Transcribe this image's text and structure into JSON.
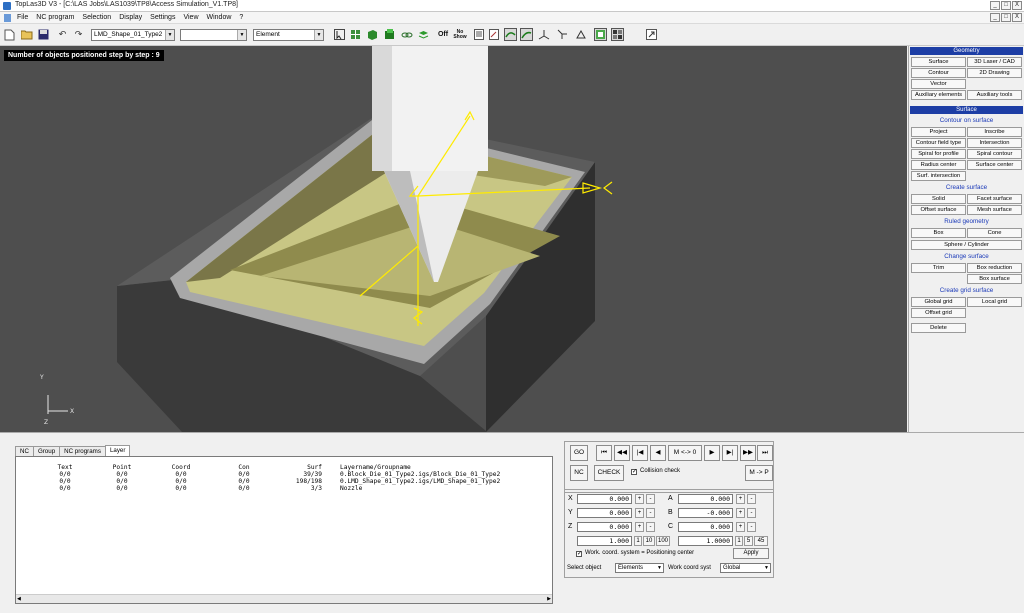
{
  "window": {
    "title": "TopLas3D V3 - [C:\\LAS Jobs\\LAS1039\\TP8\\Access Simulation_V1.TP8]",
    "minimize": "_",
    "maximize": "□",
    "close": "X"
  },
  "menu": [
    "File",
    "NC program",
    "Selection",
    "Display",
    "Settings",
    "View",
    "Window",
    "?"
  ],
  "toolbar": {
    "object_select": "LMD_Shape_01_Type2",
    "empty_select": "",
    "mode_select": "Element",
    "off_label": "Off",
    "no_show_label": "No Show"
  },
  "viewport": {
    "status": "Number of objects positioned step by step :  9"
  },
  "right_panel": {
    "geometry_header": "Geometry",
    "geometry_buttons": [
      "Surface",
      "3D Laser / CAD",
      "Contour",
      "2D Drawing",
      "Vector",
      "",
      "Auxiliary elements",
      "Auxiliary tools"
    ],
    "surface_header": "Surface",
    "contour_on_surface_title": "Contour on surface",
    "contour_on_surface_buttons": [
      "Project",
      "Inscribe",
      "Contour field type",
      "Intersection",
      "Spiral for profile",
      "Spiral contour",
      "Radius center",
      "Surface center",
      "Surf. intersection",
      ""
    ],
    "create_surface_title": "Create surface",
    "create_surface_buttons": [
      "Solid",
      "Facet surface",
      "Offset surface",
      "Mesh surface"
    ],
    "ruled_geometry_title": "Ruled geometry",
    "ruled_geometry_buttons": [
      "Box",
      "Cone"
    ],
    "sphere_cylinder": "Sphere / Cylinder",
    "change_surface_title": "Change surface",
    "change_surface_buttons": [
      "Trim",
      "Box reduction",
      "",
      "Box surface"
    ],
    "create_grid_title": "Create grid surface",
    "create_grid_buttons": [
      "Global grid",
      "Local grid",
      "Offset grid",
      ""
    ],
    "delete": "Delete"
  },
  "bottom_tabs": [
    "NC",
    "Group",
    "NC programs",
    "Layer"
  ],
  "layer_table": {
    "headers": [
      "Text",
      "Point",
      "Coord",
      "Con",
      "Surf",
      "Layername/Groupname"
    ],
    "rows": [
      [
        "0/0",
        "0/0",
        "0/0",
        "0/0",
        "39/39",
        "0.Block_Die_01_Type2.igs/Block_Die_01_Type2"
      ],
      [
        "0/0",
        "0/0",
        "0/0",
        "0/0",
        "198/198",
        "0.LMD_Shape_01_Type2.igs/LMD_Shape_01_Type2"
      ],
      [
        "0/0",
        "0/0",
        "0/0",
        "0/0",
        "3/3",
        "Nozzle"
      ]
    ]
  },
  "nc_controls": {
    "go": "GO",
    "first": "⏮",
    "fast_back": "◀◀",
    "step_back_bar": "|◀",
    "back": "◀",
    "m_to_0": "M <-> 0",
    "forward": "▶",
    "step_fwd_bar": "▶|",
    "fast_fwd": "▶▶",
    "last": "⏭",
    "nc": "NC",
    "check": "CHECK",
    "collision_check": "Collision check",
    "m_to_p": "M -> P"
  },
  "coords": {
    "X": "0.000",
    "Y": "0.000",
    "Z": "0.000",
    "A": "0.000",
    "B": "-0.000",
    "C": "0.000",
    "step_linear": "1.000",
    "step_angular": "1.0000",
    "linear_steps": [
      "1",
      "10",
      "100"
    ],
    "angular_steps": [
      "1",
      "5",
      "45"
    ],
    "plus": "+",
    "minus": "-",
    "work_coord_text": "Work. coord. system = Positioning center",
    "apply": "Apply",
    "select_object_label": "Select object",
    "select_object_value": "Elements",
    "work_coord_syst_label": "Work coord syst",
    "work_coord_syst_value": "Global"
  },
  "axis_labels": [
    "X",
    "Y",
    "Z"
  ]
}
